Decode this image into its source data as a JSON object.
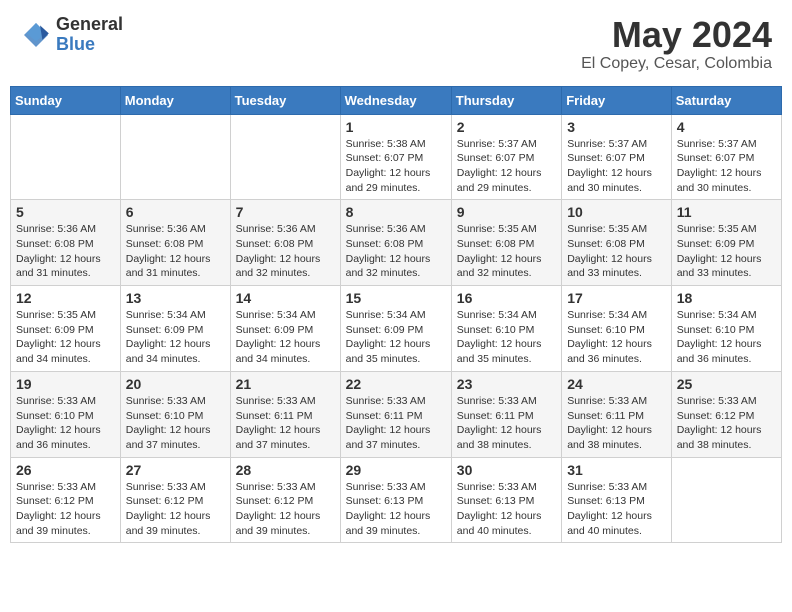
{
  "header": {
    "logo_general": "General",
    "logo_blue": "Blue",
    "month_year": "May 2024",
    "location": "El Copey, Cesar, Colombia"
  },
  "days_of_week": [
    "Sunday",
    "Monday",
    "Tuesday",
    "Wednesday",
    "Thursday",
    "Friday",
    "Saturday"
  ],
  "weeks": [
    [
      {
        "day": "",
        "info": ""
      },
      {
        "day": "",
        "info": ""
      },
      {
        "day": "",
        "info": ""
      },
      {
        "day": "1",
        "info": "Sunrise: 5:38 AM\nSunset: 6:07 PM\nDaylight: 12 hours\nand 29 minutes."
      },
      {
        "day": "2",
        "info": "Sunrise: 5:37 AM\nSunset: 6:07 PM\nDaylight: 12 hours\nand 29 minutes."
      },
      {
        "day": "3",
        "info": "Sunrise: 5:37 AM\nSunset: 6:07 PM\nDaylight: 12 hours\nand 30 minutes."
      },
      {
        "day": "4",
        "info": "Sunrise: 5:37 AM\nSunset: 6:07 PM\nDaylight: 12 hours\nand 30 minutes."
      }
    ],
    [
      {
        "day": "5",
        "info": "Sunrise: 5:36 AM\nSunset: 6:08 PM\nDaylight: 12 hours\nand 31 minutes."
      },
      {
        "day": "6",
        "info": "Sunrise: 5:36 AM\nSunset: 6:08 PM\nDaylight: 12 hours\nand 31 minutes."
      },
      {
        "day": "7",
        "info": "Sunrise: 5:36 AM\nSunset: 6:08 PM\nDaylight: 12 hours\nand 32 minutes."
      },
      {
        "day": "8",
        "info": "Sunrise: 5:36 AM\nSunset: 6:08 PM\nDaylight: 12 hours\nand 32 minutes."
      },
      {
        "day": "9",
        "info": "Sunrise: 5:35 AM\nSunset: 6:08 PM\nDaylight: 12 hours\nand 32 minutes."
      },
      {
        "day": "10",
        "info": "Sunrise: 5:35 AM\nSunset: 6:08 PM\nDaylight: 12 hours\nand 33 minutes."
      },
      {
        "day": "11",
        "info": "Sunrise: 5:35 AM\nSunset: 6:09 PM\nDaylight: 12 hours\nand 33 minutes."
      }
    ],
    [
      {
        "day": "12",
        "info": "Sunrise: 5:35 AM\nSunset: 6:09 PM\nDaylight: 12 hours\nand 34 minutes."
      },
      {
        "day": "13",
        "info": "Sunrise: 5:34 AM\nSunset: 6:09 PM\nDaylight: 12 hours\nand 34 minutes."
      },
      {
        "day": "14",
        "info": "Sunrise: 5:34 AM\nSunset: 6:09 PM\nDaylight: 12 hours\nand 34 minutes."
      },
      {
        "day": "15",
        "info": "Sunrise: 5:34 AM\nSunset: 6:09 PM\nDaylight: 12 hours\nand 35 minutes."
      },
      {
        "day": "16",
        "info": "Sunrise: 5:34 AM\nSunset: 6:10 PM\nDaylight: 12 hours\nand 35 minutes."
      },
      {
        "day": "17",
        "info": "Sunrise: 5:34 AM\nSunset: 6:10 PM\nDaylight: 12 hours\nand 36 minutes."
      },
      {
        "day": "18",
        "info": "Sunrise: 5:34 AM\nSunset: 6:10 PM\nDaylight: 12 hours\nand 36 minutes."
      }
    ],
    [
      {
        "day": "19",
        "info": "Sunrise: 5:33 AM\nSunset: 6:10 PM\nDaylight: 12 hours\nand 36 minutes."
      },
      {
        "day": "20",
        "info": "Sunrise: 5:33 AM\nSunset: 6:10 PM\nDaylight: 12 hours\nand 37 minutes."
      },
      {
        "day": "21",
        "info": "Sunrise: 5:33 AM\nSunset: 6:11 PM\nDaylight: 12 hours\nand 37 minutes."
      },
      {
        "day": "22",
        "info": "Sunrise: 5:33 AM\nSunset: 6:11 PM\nDaylight: 12 hours\nand 37 minutes."
      },
      {
        "day": "23",
        "info": "Sunrise: 5:33 AM\nSunset: 6:11 PM\nDaylight: 12 hours\nand 38 minutes."
      },
      {
        "day": "24",
        "info": "Sunrise: 5:33 AM\nSunset: 6:11 PM\nDaylight: 12 hours\nand 38 minutes."
      },
      {
        "day": "25",
        "info": "Sunrise: 5:33 AM\nSunset: 6:12 PM\nDaylight: 12 hours\nand 38 minutes."
      }
    ],
    [
      {
        "day": "26",
        "info": "Sunrise: 5:33 AM\nSunset: 6:12 PM\nDaylight: 12 hours\nand 39 minutes."
      },
      {
        "day": "27",
        "info": "Sunrise: 5:33 AM\nSunset: 6:12 PM\nDaylight: 12 hours\nand 39 minutes."
      },
      {
        "day": "28",
        "info": "Sunrise: 5:33 AM\nSunset: 6:12 PM\nDaylight: 12 hours\nand 39 minutes."
      },
      {
        "day": "29",
        "info": "Sunrise: 5:33 AM\nSunset: 6:13 PM\nDaylight: 12 hours\nand 39 minutes."
      },
      {
        "day": "30",
        "info": "Sunrise: 5:33 AM\nSunset: 6:13 PM\nDaylight: 12 hours\nand 40 minutes."
      },
      {
        "day": "31",
        "info": "Sunrise: 5:33 AM\nSunset: 6:13 PM\nDaylight: 12 hours\nand 40 minutes."
      },
      {
        "day": "",
        "info": ""
      }
    ]
  ]
}
